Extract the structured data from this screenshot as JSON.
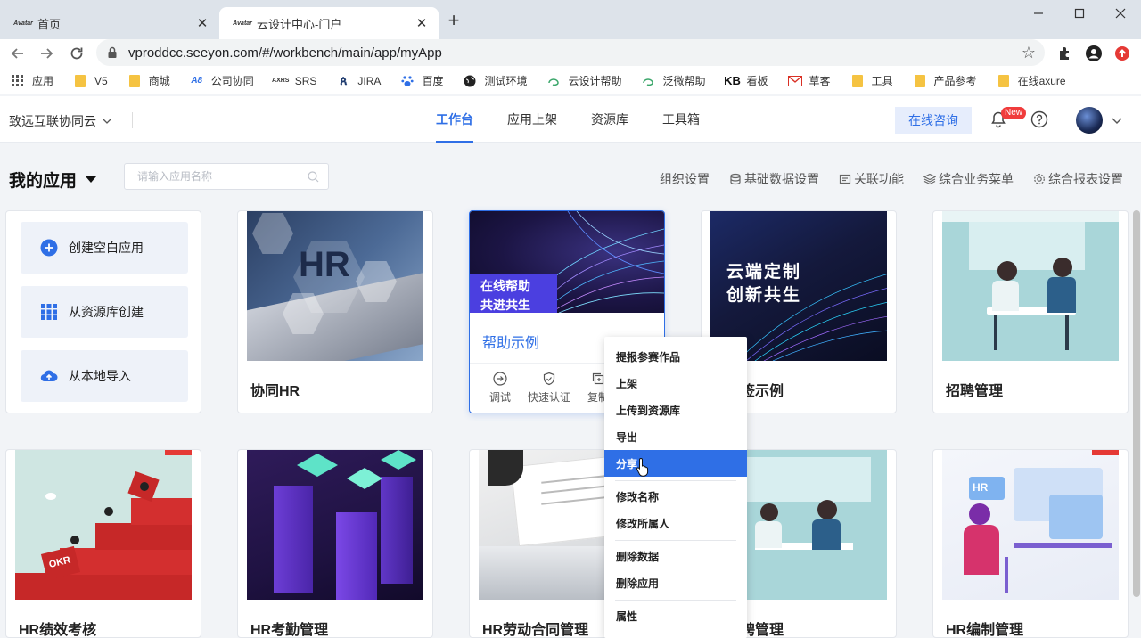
{
  "browser": {
    "tabs": [
      {
        "title": "首页",
        "favicon": "Avatar"
      },
      {
        "title": "云设计中心-门户",
        "favicon": "Avatar"
      }
    ],
    "url": "vproddcc.seeyon.com/#/workbench/main/app/myApp",
    "bookmarks": [
      {
        "label": "应用",
        "icon": "apps-grid-icon"
      },
      {
        "label": "V5",
        "icon": "folder-icon"
      },
      {
        "label": "商城",
        "icon": "folder-icon"
      },
      {
        "label": "公司协同",
        "icon": "a8-icon"
      },
      {
        "label": "SRS",
        "icon": "axure-icon"
      },
      {
        "label": "JIRA",
        "icon": "jira-icon"
      },
      {
        "label": "百度",
        "icon": "baidu-icon"
      },
      {
        "label": "测试环境",
        "icon": "globe-icon"
      },
      {
        "label": "云设计帮助",
        "icon": "seeyon-icon"
      },
      {
        "label": "泛微帮助",
        "icon": "seeyon-icon"
      },
      {
        "label": "看板",
        "icon": "kb-icon"
      },
      {
        "label": "草客",
        "icon": "mail-icon"
      },
      {
        "label": "工具",
        "icon": "folder-icon"
      },
      {
        "label": "产品参考",
        "icon": "folder-icon"
      },
      {
        "label": "在线axure",
        "icon": "folder-icon"
      }
    ]
  },
  "header": {
    "org": "致远互联协同云",
    "nav": [
      {
        "label": "工作台",
        "active": true
      },
      {
        "label": "应用上架",
        "active": false
      },
      {
        "label": "资源库",
        "active": false
      },
      {
        "label": "工具箱",
        "active": false
      }
    ],
    "consult": "在线咨询",
    "badge": "New"
  },
  "subheader": {
    "title": "我的应用",
    "search_placeholder": "请输入应用名称",
    "actions": [
      "组织设置",
      "基础数据设置",
      "关联功能",
      "综合业务菜单",
      "综合报表设置"
    ]
  },
  "quick_actions": [
    "创建空白应用",
    "从资源库创建",
    "从本地导入"
  ],
  "cards_row1": [
    {
      "name": "协同HR"
    },
    {
      "name": "帮助示例",
      "banner": [
        "在线帮助",
        "共进共生"
      ],
      "tools": [
        "调试",
        "快速认证",
        "复制"
      ]
    },
    {
      "name": "签示例",
      "banner": [
        "云端定制",
        "创新共生"
      ]
    },
    {
      "name": "招聘管理"
    }
  ],
  "cards_row2": [
    {
      "name": "HR绩效考核",
      "thumb_text": "OKR"
    },
    {
      "name": "HR考勤管理"
    },
    {
      "name": "HR劳动合同管理"
    },
    {
      "name": "聘管理"
    },
    {
      "name": "HR编制管理",
      "thumb_text": "HR"
    }
  ],
  "thumb_text": {
    "hr": "HR"
  },
  "context_menu": [
    {
      "label": "提报参赛作品"
    },
    {
      "label": "上架"
    },
    {
      "label": "上传到资源库"
    },
    {
      "label": "导出"
    },
    {
      "label": "分享",
      "selected": true
    },
    {
      "label": "修改名称"
    },
    {
      "label": "修改所属人"
    },
    {
      "label": "删除数据"
    },
    {
      "label": "删除应用"
    },
    {
      "label": "属性"
    }
  ],
  "colors": {
    "accent": "#2f6fe6",
    "banner": "#4b3fe0",
    "badge": "#f03c3c"
  }
}
